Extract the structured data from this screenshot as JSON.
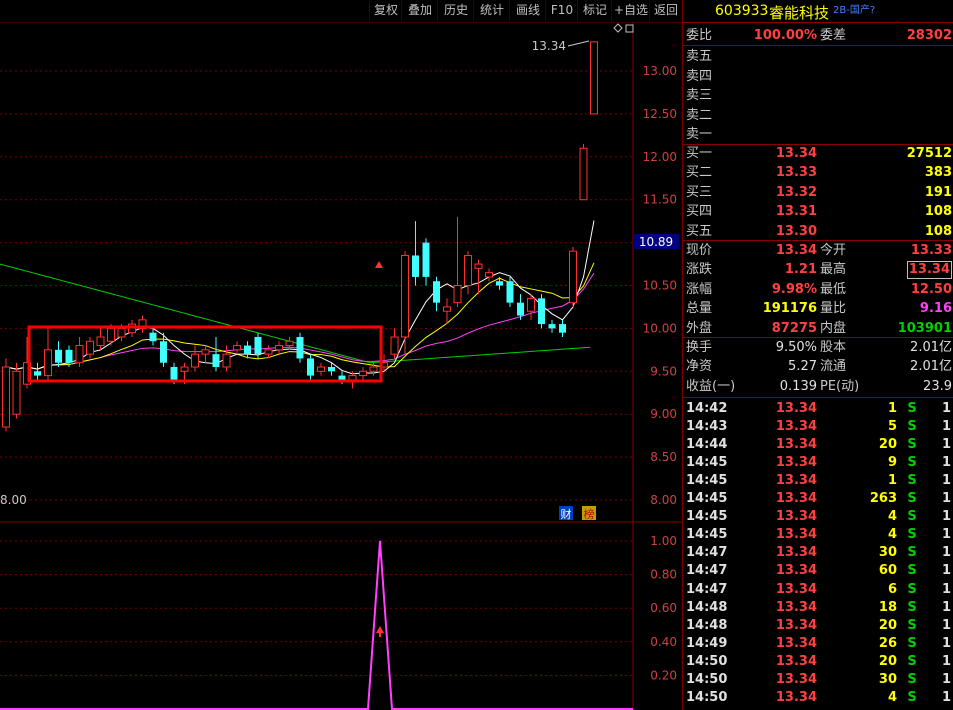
{
  "toolbar": {
    "buttons": [
      "复权",
      "叠加",
      "历史",
      "统计",
      "画线",
      "F10",
      "标记",
      "+自选",
      "返回"
    ]
  },
  "stock": {
    "code": "603933",
    "name": "睿能科技",
    "tag": "2B-国产?"
  },
  "chart": {
    "ylabels": [
      "13.00",
      "12.50",
      "12.00",
      "11.50",
      "11.00",
      "10.50",
      "10.00",
      "9.50",
      "9.00",
      "8.50",
      "8.00"
    ],
    "sub_ylabels": [
      "1.00",
      "0.80",
      "0.60",
      "0.40",
      "0.20"
    ],
    "high_annotation": "13.34",
    "current_price_tag": "10.89",
    "left_edge_label": "8.00",
    "badge_cai": "财",
    "badge_bang": "榜",
    "icons": [
      "diamond-icon",
      "window-icon"
    ],
    "colors": {
      "up": "#ff3030",
      "down": "#40ffff",
      "ma1": "#ffffff",
      "ma2": "#ffff00",
      "ma3": "#ff40ff",
      "ma4": "#00d000",
      "box": "#ff0000"
    }
  },
  "chart_data": {
    "type": "candlestick",
    "ylim": [
      8.0,
      13.5
    ],
    "sub_ylim": [
      0,
      1.0
    ],
    "candles": [
      {
        "o": 8.85,
        "c": 9.55,
        "h": 9.65,
        "l": 8.8
      },
      {
        "o": 9.0,
        "c": 9.5,
        "h": 9.6,
        "l": 8.95
      },
      {
        "o": 9.35,
        "c": 9.6,
        "h": 9.9,
        "l": 9.3
      },
      {
        "o": 9.5,
        "c": 9.45,
        "h": 9.6,
        "l": 9.4
      },
      {
        "o": 9.45,
        "c": 9.75,
        "h": 10.0,
        "l": 9.4
      },
      {
        "o": 9.75,
        "c": 9.6,
        "h": 9.85,
        "l": 9.55
      },
      {
        "o": 9.75,
        "c": 9.6,
        "h": 9.8,
        "l": 9.55
      },
      {
        "o": 9.6,
        "c": 9.8,
        "h": 9.9,
        "l": 9.55
      },
      {
        "o": 9.7,
        "c": 9.85,
        "h": 9.9,
        "l": 9.65
      },
      {
        "o": 9.8,
        "c": 9.9,
        "h": 10.0,
        "l": 9.75
      },
      {
        "o": 9.85,
        "c": 10.0,
        "h": 10.05,
        "l": 9.8
      },
      {
        "o": 9.9,
        "c": 10.0,
        "h": 10.05,
        "l": 9.85
      },
      {
        "o": 9.95,
        "c": 10.05,
        "h": 10.1,
        "l": 9.9
      },
      {
        "o": 10.0,
        "c": 10.1,
        "h": 10.15,
        "l": 9.95
      },
      {
        "o": 9.95,
        "c": 9.85,
        "h": 10.0,
        "l": 9.8
      },
      {
        "o": 9.85,
        "c": 9.6,
        "h": 9.95,
        "l": 9.55
      },
      {
        "o": 9.55,
        "c": 9.4,
        "h": 9.6,
        "l": 9.35
      },
      {
        "o": 9.5,
        "c": 9.55,
        "h": 9.6,
        "l": 9.35
      },
      {
        "o": 9.55,
        "c": 9.7,
        "h": 9.8,
        "l": 9.5
      },
      {
        "o": 9.7,
        "c": 9.75,
        "h": 9.8,
        "l": 9.6
      },
      {
        "o": 9.7,
        "c": 9.55,
        "h": 9.9,
        "l": 9.5
      },
      {
        "o": 9.55,
        "c": 9.7,
        "h": 9.8,
        "l": 9.5
      },
      {
        "o": 9.75,
        "c": 9.8,
        "h": 9.85,
        "l": 9.7
      },
      {
        "o": 9.8,
        "c": 9.7,
        "h": 9.85,
        "l": 9.65
      },
      {
        "o": 9.9,
        "c": 9.7,
        "h": 9.95,
        "l": 9.65
      },
      {
        "o": 9.7,
        "c": 9.75,
        "h": 9.8,
        "l": 9.65
      },
      {
        "o": 9.75,
        "c": 9.8,
        "h": 9.85,
        "l": 9.7
      },
      {
        "o": 9.8,
        "c": 9.85,
        "h": 9.9,
        "l": 9.75
      },
      {
        "o": 9.9,
        "c": 9.65,
        "h": 9.95,
        "l": 9.6
      },
      {
        "o": 9.65,
        "c": 9.45,
        "h": 9.7,
        "l": 9.4
      },
      {
        "o": 9.5,
        "c": 9.55,
        "h": 9.6,
        "l": 9.45
      },
      {
        "o": 9.55,
        "c": 9.5,
        "h": 9.6,
        "l": 9.45
      },
      {
        "o": 9.45,
        "c": 9.4,
        "h": 9.5,
        "l": 9.35
      },
      {
        "o": 9.4,
        "c": 9.45,
        "h": 9.5,
        "l": 9.3
      },
      {
        "o": 9.45,
        "c": 9.5,
        "h": 9.55,
        "l": 9.4
      },
      {
        "o": 9.5,
        "c": 9.55,
        "h": 9.6,
        "l": 9.45
      },
      {
        "o": 9.55,
        "c": 9.6,
        "h": 9.7,
        "l": 9.5
      },
      {
        "o": 9.7,
        "c": 9.9,
        "h": 10.0,
        "l": 9.65
      },
      {
        "o": 9.9,
        "c": 10.85,
        "h": 10.9,
        "l": 9.7
      },
      {
        "o": 10.85,
        "c": 10.6,
        "h": 11.25,
        "l": 10.5
      },
      {
        "o": 11.0,
        "c": 10.6,
        "h": 11.05,
        "l": 10.5
      },
      {
        "o": 10.55,
        "c": 10.3,
        "h": 10.6,
        "l": 10.2
      },
      {
        "o": 10.2,
        "c": 10.25,
        "h": 10.35,
        "l": 10.05
      },
      {
        "o": 10.3,
        "c": 10.5,
        "h": 11.3,
        "l": 10.25
      },
      {
        "o": 10.5,
        "c": 10.85,
        "h": 10.9,
        "l": 10.4
      },
      {
        "o": 10.7,
        "c": 10.75,
        "h": 10.8,
        "l": 10.4
      },
      {
        "o": 10.6,
        "c": 10.65,
        "h": 10.7,
        "l": 10.55
      },
      {
        "o": 10.55,
        "c": 10.5,
        "h": 10.6,
        "l": 10.45
      },
      {
        "o": 10.55,
        "c": 10.3,
        "h": 10.6,
        "l": 10.25
      },
      {
        "o": 10.3,
        "c": 10.15,
        "h": 10.4,
        "l": 10.1
      },
      {
        "o": 10.2,
        "c": 10.35,
        "h": 10.4,
        "l": 10.1
      },
      {
        "o": 10.35,
        "c": 10.05,
        "h": 10.4,
        "l": 10.0
      },
      {
        "o": 10.05,
        "c": 10.0,
        "h": 10.1,
        "l": 9.95
      },
      {
        "o": 10.05,
        "c": 9.95,
        "h": 10.1,
        "l": 9.9
      },
      {
        "o": 10.3,
        "c": 10.9,
        "h": 10.95,
        "l": 10.25
      },
      {
        "o": 11.5,
        "c": 12.1,
        "h": 12.15,
        "l": 11.5
      },
      {
        "o": 12.5,
        "c": 13.34,
        "h": 13.34,
        "l": 12.5
      }
    ],
    "signal_peak_value": 1.0
  },
  "quote": {
    "weibi_label": "委比",
    "weibi": "100.00%",
    "weicha_label": "委差",
    "weicha": "28302",
    "sells": [
      {
        "label": "卖五"
      },
      {
        "label": "卖四"
      },
      {
        "label": "卖三"
      },
      {
        "label": "卖二"
      },
      {
        "label": "卖一"
      }
    ],
    "buys": [
      {
        "label": "买一",
        "price": "13.34",
        "vol": "27512"
      },
      {
        "label": "买二",
        "price": "13.33",
        "vol": "383"
      },
      {
        "label": "买三",
        "price": "13.32",
        "vol": "191"
      },
      {
        "label": "买四",
        "price": "13.31",
        "vol": "108"
      },
      {
        "label": "买五",
        "price": "13.30",
        "vol": "108"
      }
    ],
    "stats1": [
      {
        "l1": "现价",
        "v1": "13.34",
        "c1": "red",
        "l2": "今开",
        "v2": "13.33",
        "c2": "red"
      },
      {
        "l1": "涨跌",
        "v1": "1.21",
        "c1": "red",
        "l2": "最高",
        "v2": "13.34",
        "c2": "red"
      },
      {
        "l1": "涨幅",
        "v1": "9.98%",
        "c1": "red",
        "l2": "最低",
        "v2": "12.50",
        "c2": "red"
      },
      {
        "l1": "总量",
        "v1": "191176",
        "c1": "yellow",
        "l2": "量比",
        "v2": "9.16",
        "c2": "magenta"
      },
      {
        "l1": "外盘",
        "v1": "87275",
        "c1": "red",
        "l2": "内盘",
        "v2": "103901",
        "c2": "green"
      }
    ],
    "stats2": [
      {
        "l1": "换手",
        "v1": "9.50%",
        "l2": "股本",
        "v2": "2.01亿"
      },
      {
        "l1": "净资",
        "v1": "5.27",
        "l2": "流通",
        "v2": "2.01亿"
      },
      {
        "l1": "收益(一)",
        "v1": "0.139",
        "l2": "PE(动)",
        "v2": "23.9"
      }
    ]
  },
  "ticks": [
    {
      "t": "14:42",
      "p": "13.34",
      "v": "1",
      "s": "S",
      "n": "1"
    },
    {
      "t": "14:43",
      "p": "13.34",
      "v": "5",
      "s": "S",
      "n": "1"
    },
    {
      "t": "14:44",
      "p": "13.34",
      "v": "20",
      "s": "S",
      "n": "1"
    },
    {
      "t": "14:45",
      "p": "13.34",
      "v": "9",
      "s": "S",
      "n": "1"
    },
    {
      "t": "14:45",
      "p": "13.34",
      "v": "1",
      "s": "S",
      "n": "1"
    },
    {
      "t": "14:45",
      "p": "13.34",
      "v": "263",
      "s": "S",
      "n": "1"
    },
    {
      "t": "14:45",
      "p": "13.34",
      "v": "4",
      "s": "S",
      "n": "1"
    },
    {
      "t": "14:45",
      "p": "13.34",
      "v": "4",
      "s": "S",
      "n": "1"
    },
    {
      "t": "14:47",
      "p": "13.34",
      "v": "30",
      "s": "S",
      "n": "1"
    },
    {
      "t": "14:47",
      "p": "13.34",
      "v": "60",
      "s": "S",
      "n": "1"
    },
    {
      "t": "14:47",
      "p": "13.34",
      "v": "6",
      "s": "S",
      "n": "1"
    },
    {
      "t": "14:48",
      "p": "13.34",
      "v": "18",
      "s": "S",
      "n": "1"
    },
    {
      "t": "14:48",
      "p": "13.34",
      "v": "20",
      "s": "S",
      "n": "1"
    },
    {
      "t": "14:49",
      "p": "13.34",
      "v": "26",
      "s": "S",
      "n": "1"
    },
    {
      "t": "14:50",
      "p": "13.34",
      "v": "20",
      "s": "S",
      "n": "1"
    },
    {
      "t": "14:50",
      "p": "13.34",
      "v": "30",
      "s": "S",
      "n": "1"
    },
    {
      "t": "14:50",
      "p": "13.34",
      "v": "4",
      "s": "S",
      "n": "1"
    }
  ]
}
